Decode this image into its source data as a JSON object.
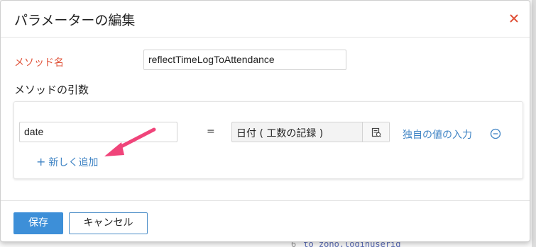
{
  "dialog": {
    "title": "パラメーターの編集",
    "close_icon": "close-x-icon"
  },
  "method": {
    "label": "メソッド名",
    "value": "reflectTimeLogToAttendance"
  },
  "arguments": {
    "heading": "メソッドの引数",
    "rows": [
      {
        "name": "date",
        "equals": "=",
        "value": "日付 ( 工数の記録 )",
        "picker_icon": "field-picker-icon",
        "custom_value_label": "独自の値の入力",
        "remove_icon": "minus-circle-icon"
      }
    ],
    "add_new_label": "新しく追加",
    "add_icon": "plus-icon"
  },
  "annotation": {
    "arrow_color": "#f0447a"
  },
  "footer": {
    "save_label": "保存",
    "cancel_label": "キャンセル"
  },
  "background": {
    "code_line_number": "6",
    "code_text": "to zoho.loginuserid"
  },
  "colors": {
    "accent": "#3d8fd8",
    "required_label": "#e0533a",
    "link": "#3e83c4"
  }
}
